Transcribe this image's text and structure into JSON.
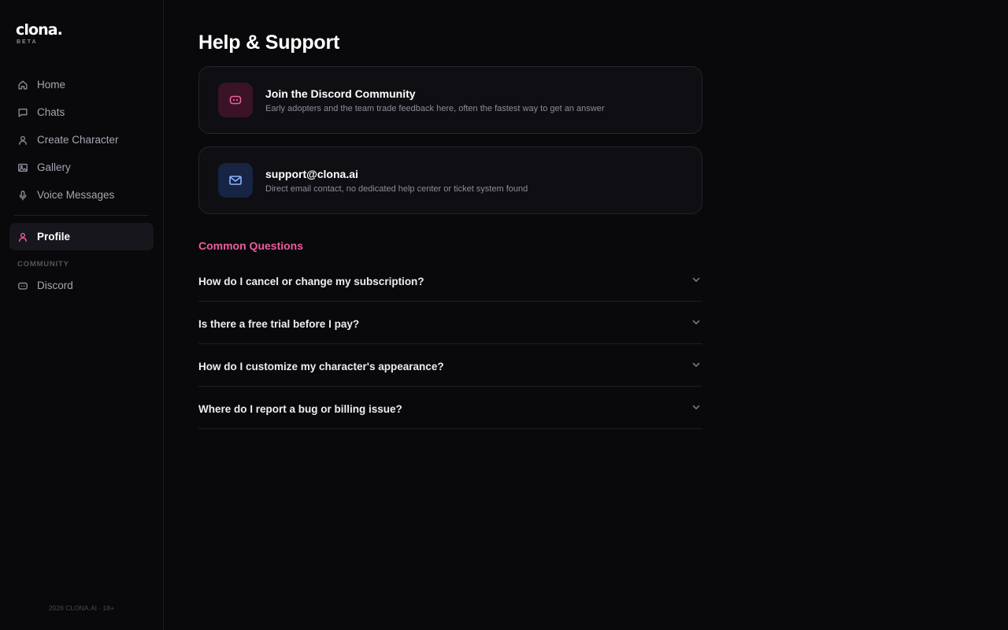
{
  "brand": {
    "name": "clona.",
    "tag": "BETA"
  },
  "sidebar": {
    "items": [
      {
        "label": "Home",
        "icon": "home-icon"
      },
      {
        "label": "Chats",
        "icon": "chat-icon"
      },
      {
        "label": "Create Character",
        "icon": "user-icon"
      },
      {
        "label": "Gallery",
        "icon": "image-icon"
      },
      {
        "label": "Voice Messages",
        "icon": "mic-icon"
      }
    ],
    "active_item": {
      "label": "Profile",
      "icon": "user-icon"
    },
    "section_label": "COMMUNITY",
    "community_items": [
      {
        "label": "Discord",
        "icon": "discord-icon"
      }
    ],
    "footer": "2026 CLONA.AI · 18+"
  },
  "main": {
    "title": "Help & Support",
    "cards": [
      {
        "title": "Join the Discord Community",
        "description": "Early adopters and the team trade feedback here, often the fastest way to get an answer",
        "icon": "discord-icon",
        "color": "#ec5d9e"
      },
      {
        "title": "support@clona.ai",
        "description": "Direct email contact, no dedicated help center or ticket system found",
        "icon": "mail-icon",
        "color": "#8fb4ff"
      }
    ],
    "faq_heading": "Common Questions",
    "faq": [
      {
        "question": "How do I cancel or change my subscription?"
      },
      {
        "question": "Is there a free trial before I pay?"
      },
      {
        "question": "How do I customize my character's appearance?"
      },
      {
        "question": "Where do I report a bug or billing issue?"
      }
    ]
  },
  "colors": {
    "accent": "#ec5d9e",
    "background": "#09080b",
    "card": "#0f0e13"
  }
}
